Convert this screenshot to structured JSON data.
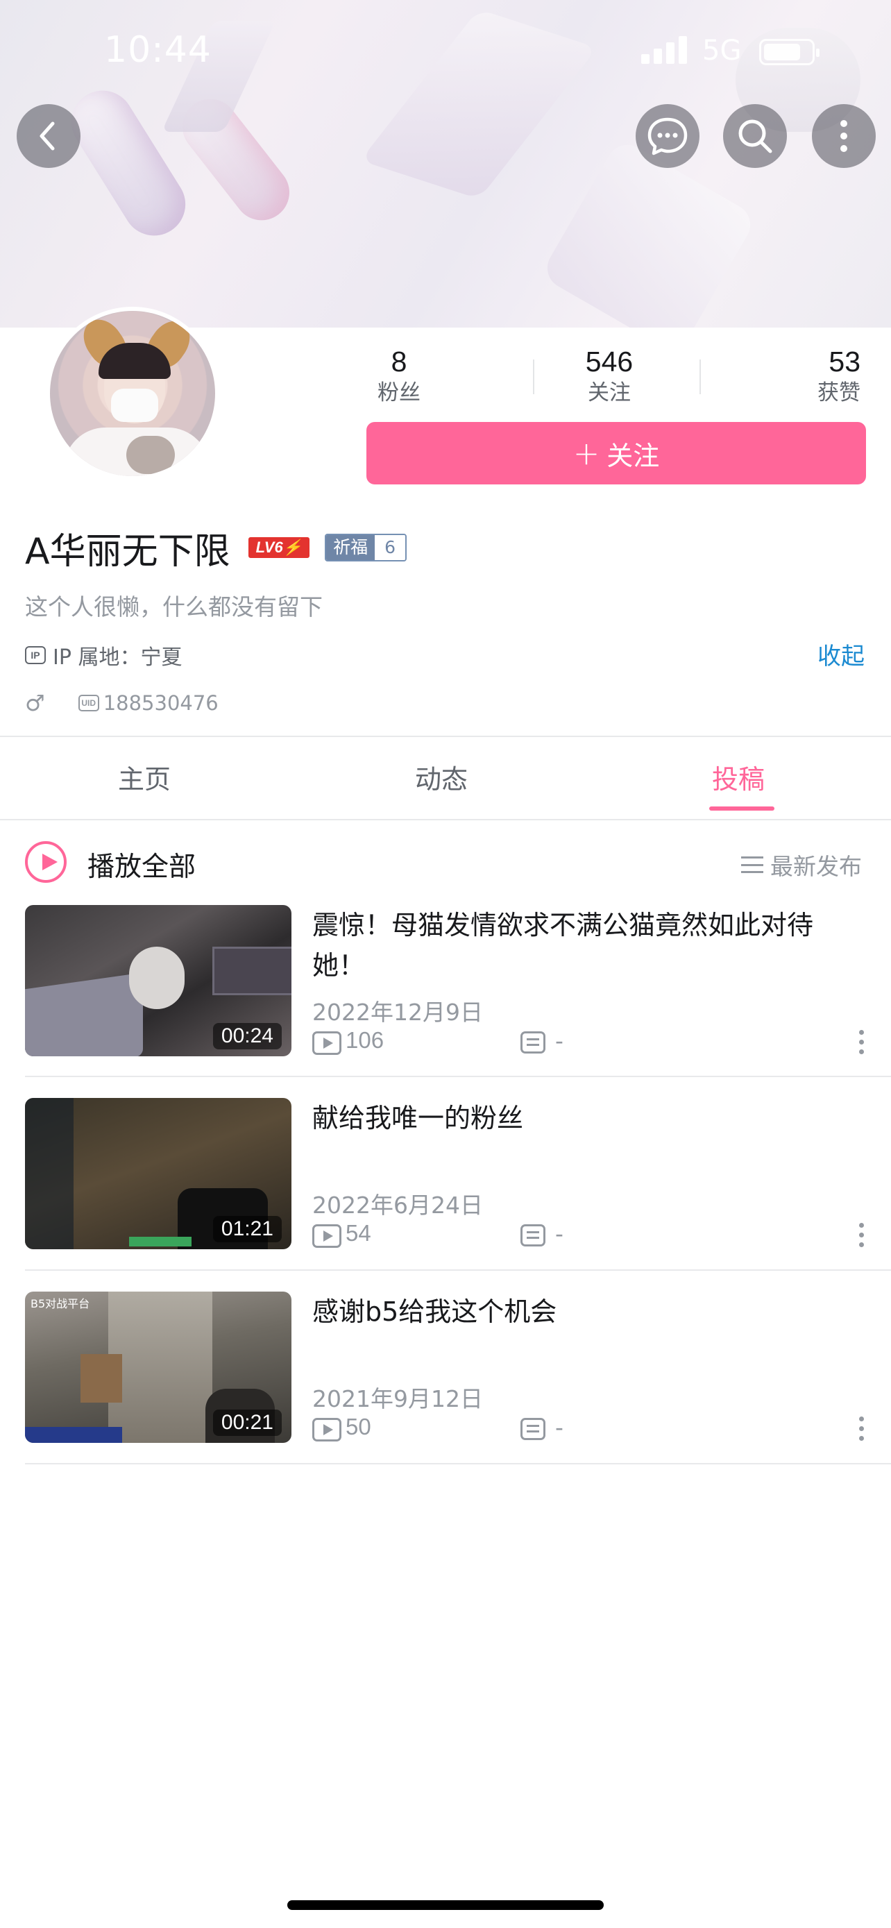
{
  "status_bar": {
    "time": "10:44",
    "network": "5G"
  },
  "header": {
    "back_icon": "chevron-left-icon",
    "message_icon": "chat-bubble-icon",
    "search_icon": "search-icon",
    "more_icon": "more-vertical-icon"
  },
  "profile": {
    "stats": [
      {
        "value": "8",
        "label": "粉丝"
      },
      {
        "value": "546",
        "label": "关注"
      },
      {
        "value": "53",
        "label": "获赞"
      }
    ],
    "follow_button": {
      "plus": "+",
      "label": "关注"
    },
    "name": "A华丽无下限",
    "level_badge": "LV6⚡",
    "medal": {
      "name": "祈福",
      "level": "6"
    },
    "signature": "这个人很懒，什么都没有留下",
    "ip_icon_text": "IP",
    "ip_location": "IP 属地：宁夏",
    "collapse_label": "收起",
    "gender_symbol": "♂",
    "uid_icon_text": "UID",
    "uid": "188530476"
  },
  "tabs": [
    {
      "label": "主页",
      "active": false
    },
    {
      "label": "动态",
      "active": false
    },
    {
      "label": "投稿",
      "active": true
    }
  ],
  "accent_color": "#ff6699",
  "list_header": {
    "play_all": "播放全部",
    "sort": "最新发布"
  },
  "videos": [
    {
      "title": "震惊！母猫发情欲求不满公猫竟然如此对待她！",
      "duration": "00:24",
      "date": "2022年12月9日",
      "plays": "106",
      "danmaku": "-"
    },
    {
      "title": "献给我唯一的粉丝",
      "duration": "01:21",
      "date": "2022年6月24日",
      "plays": "54",
      "danmaku": "-"
    },
    {
      "title": "感谢b5给我这个机会",
      "duration": "00:21",
      "date": "2021年9月12日",
      "plays": "50",
      "danmaku": "-",
      "thumb_text": "B5对战平台"
    }
  ]
}
